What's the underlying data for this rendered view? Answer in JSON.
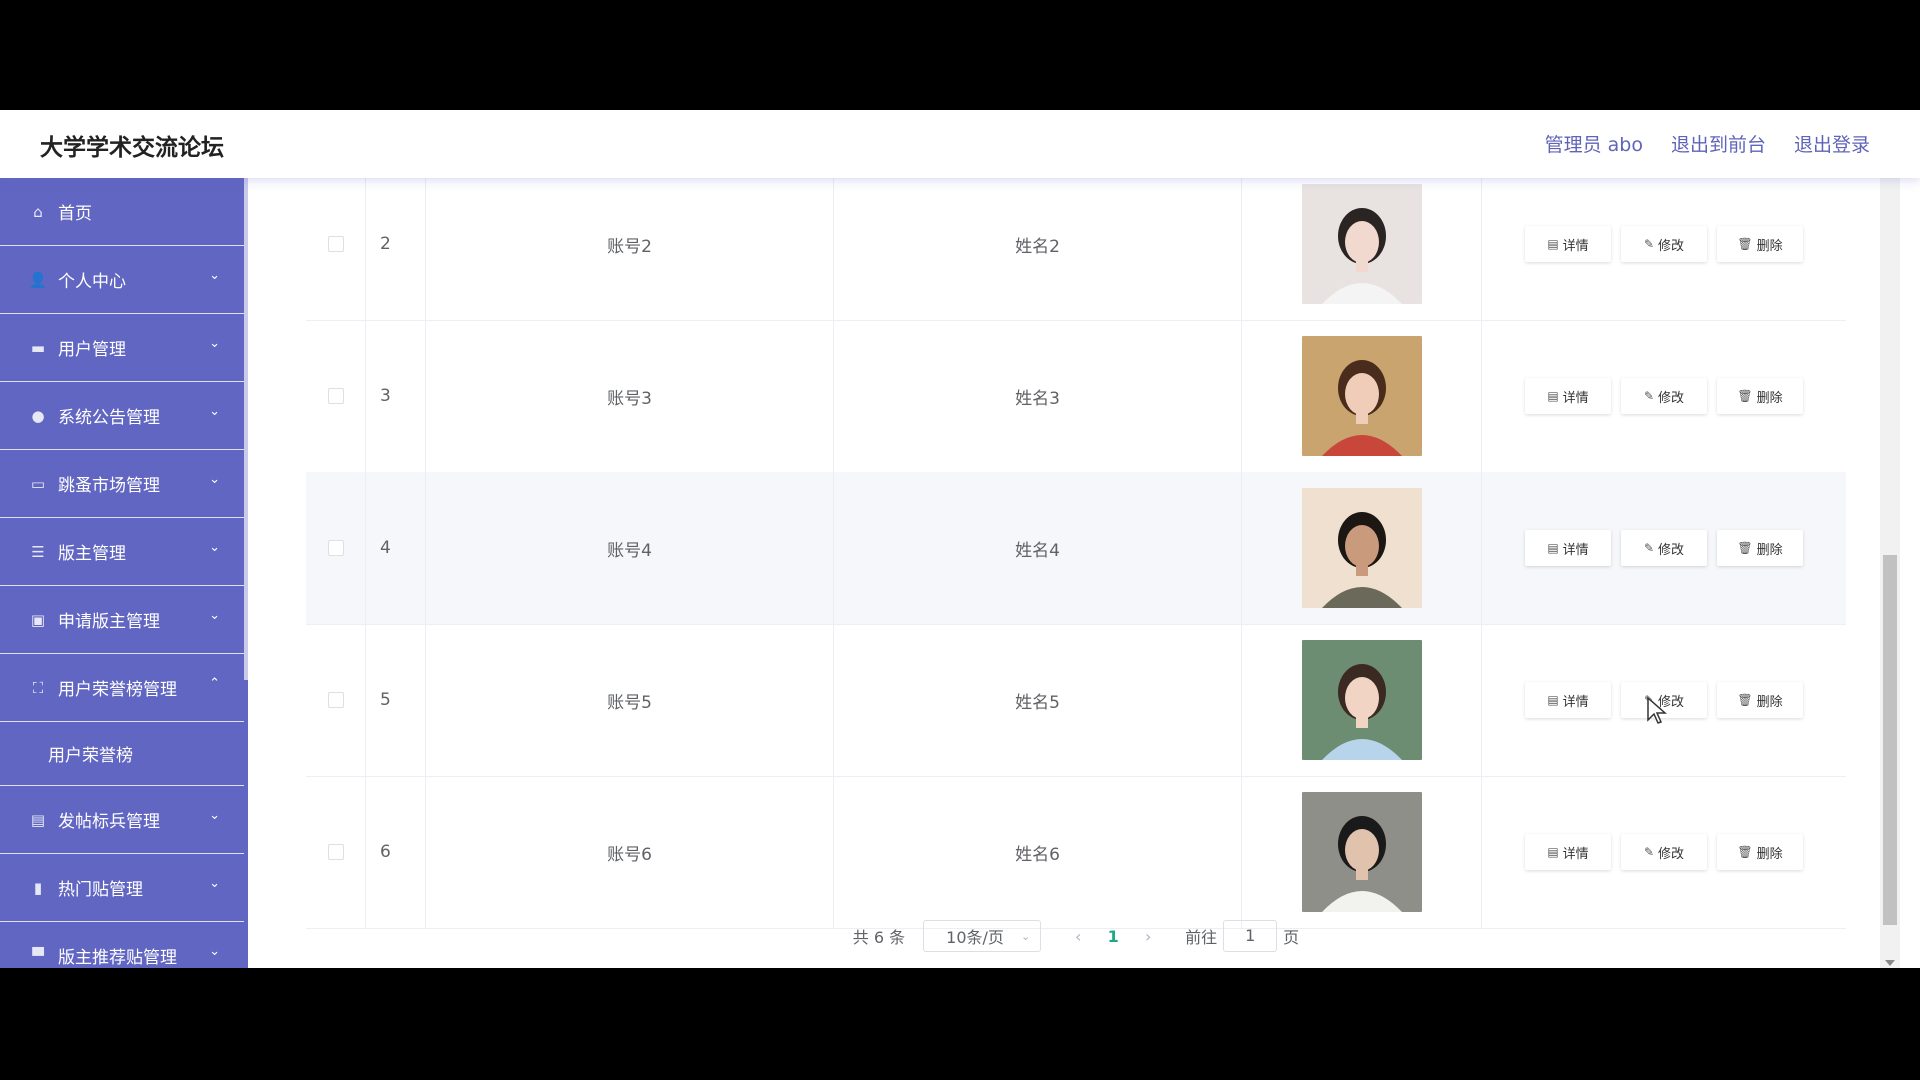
{
  "header": {
    "brand": "大学学术交流论坛",
    "admin_label": "管理员 abo",
    "exit_front": "退出到前台",
    "logout": "退出登录"
  },
  "sidebar": {
    "items": [
      {
        "label": "首页",
        "icon": "home-icon",
        "glyph": "⌂",
        "chevron": ""
      },
      {
        "label": "个人中心",
        "icon": "user-icon",
        "glyph": "👤",
        "chevron": "⌄"
      },
      {
        "label": "用户管理",
        "icon": "briefcase-icon",
        "glyph": "▬",
        "chevron": "⌄"
      },
      {
        "label": "系统公告管理",
        "icon": "pin-icon",
        "glyph": "●",
        "chevron": "⌄"
      },
      {
        "label": "跳蚤市场管理",
        "icon": "comment-icon",
        "glyph": "▭",
        "chevron": "⌄"
      },
      {
        "label": "版主管理",
        "icon": "sliders-icon",
        "glyph": "☰",
        "chevron": "⌄"
      },
      {
        "label": "申请版主管理",
        "icon": "card-icon",
        "glyph": "▣",
        "chevron": "⌄"
      },
      {
        "label": "用户荣誉榜管理",
        "icon": "fullscreen-icon",
        "glyph": "⛶",
        "chevron": "⌃"
      }
    ],
    "sub_item": "用户荣誉榜",
    "items_after": [
      {
        "label": "发帖标兵管理",
        "icon": "clipboard-icon",
        "glyph": "▤",
        "chevron": "⌄"
      },
      {
        "label": "热门贴管理",
        "icon": "microphone-icon",
        "glyph": "▮",
        "chevron": "⌄"
      },
      {
        "label": "版主推荐贴管理",
        "icon": "monitor-icon",
        "glyph": "▀",
        "chevron": "⌄"
      }
    ]
  },
  "table": {
    "rows": [
      {
        "index": "2",
        "account": "账号2",
        "name": "姓名2"
      },
      {
        "index": "3",
        "account": "账号3",
        "name": "姓名3"
      },
      {
        "index": "4",
        "account": "账号4",
        "name": "姓名4"
      },
      {
        "index": "5",
        "account": "账号5",
        "name": "姓名5"
      },
      {
        "index": "6",
        "account": "账号6",
        "name": "姓名6"
      }
    ],
    "actions": {
      "detail": "详情",
      "edit": "修改",
      "delete": "删除"
    }
  },
  "pagination": {
    "total": "共 6 条",
    "page_size": "10条/页",
    "current": "1",
    "goto_prefix": "前往",
    "goto_value": "1",
    "goto_suffix": "页"
  },
  "colors": {
    "sidebar": "#6166c2",
    "accent_link": "#6064b8",
    "page_active": "#1faa85"
  }
}
